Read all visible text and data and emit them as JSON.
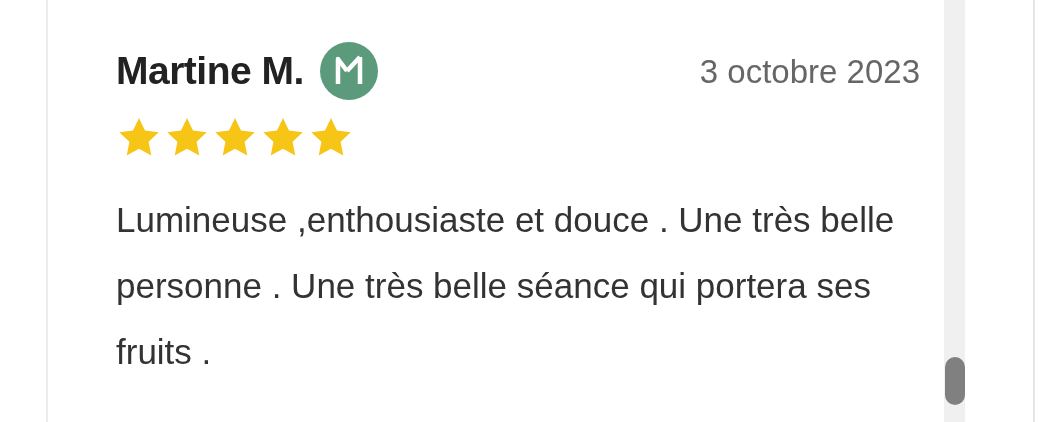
{
  "review": {
    "author": "Martine M.",
    "date": "3 octobre 2023",
    "stars": 5,
    "text": "Lumineuse ,enthousiaste et douce . Une très belle personne . Une très belle séance qui portera ses fruits ."
  }
}
